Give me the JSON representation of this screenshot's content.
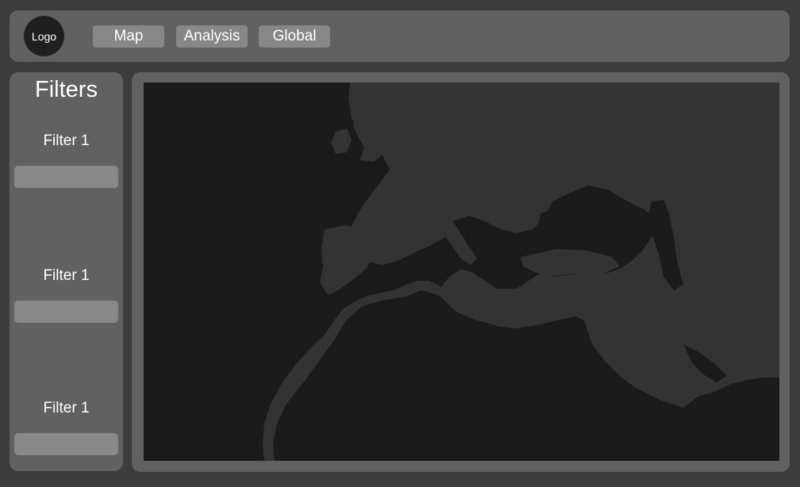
{
  "header": {
    "logo_text": "Logo",
    "nav": [
      {
        "label": "Map"
      },
      {
        "label": "Analysis"
      },
      {
        "label": "Global"
      }
    ]
  },
  "sidebar": {
    "title": "Filters",
    "filters": [
      {
        "label": "Filter 1",
        "value": ""
      },
      {
        "label": "Filter 1",
        "value": ""
      },
      {
        "label": "Filter 1",
        "value": ""
      }
    ]
  },
  "colors": {
    "background": "#3c3c3c",
    "panel": "#616161",
    "button": "#878787",
    "map_water": "#1b1b1b",
    "map_land": "#333333"
  }
}
